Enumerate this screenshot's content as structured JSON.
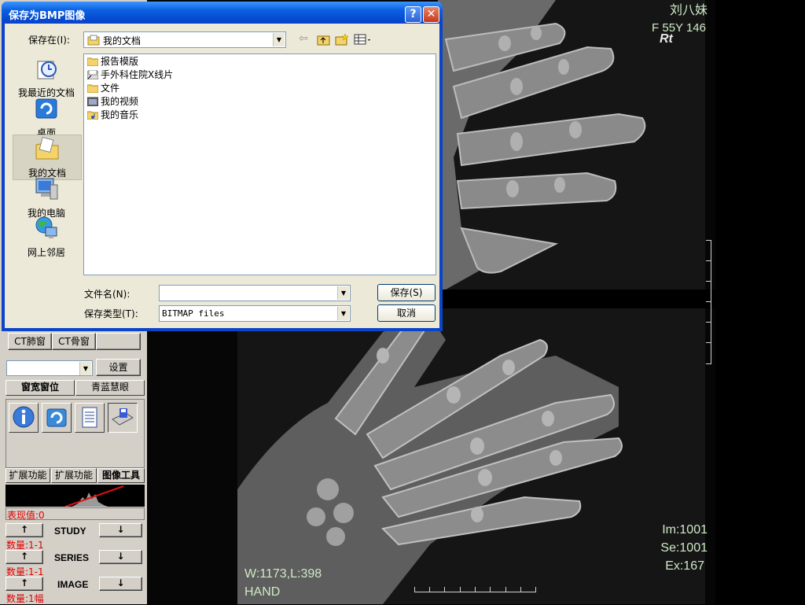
{
  "dialog": {
    "title": "保存为BMP图像",
    "help_label": "?",
    "close_label": "✕",
    "save_in_label": "保存在(I):",
    "save_in_value": "我的文档",
    "places": [
      {
        "label": "我最近的文档",
        "icon": "recent-docs-icon"
      },
      {
        "label": "桌面",
        "icon": "desktop-icon"
      },
      {
        "label": "我的文档",
        "icon": "my-documents-icon"
      },
      {
        "label": "我的电脑",
        "icon": "my-computer-icon"
      },
      {
        "label": "网上邻居",
        "icon": "network-places-icon"
      }
    ],
    "files": [
      {
        "name": "报告模版",
        "icon": "folder-icon"
      },
      {
        "name": "手外科住院X线片",
        "icon": "shortcut-folder-icon"
      },
      {
        "name": "文件",
        "icon": "folder-icon"
      },
      {
        "name": "我的视频",
        "icon": "video-folder-icon"
      },
      {
        "name": "我的音乐",
        "icon": "music-folder-icon"
      }
    ],
    "filename_label": "文件名(N):",
    "filename_value": "",
    "filetype_label": "保存类型(T):",
    "filetype_value": "BITMAP files",
    "save_button": "保存(S)",
    "cancel_button": "取消"
  },
  "left_panel": {
    "ct_lung": "CT肺窗",
    "ct_bone": "CT骨窗",
    "settings_button": "设置",
    "preset_select_value": "",
    "tab_window": "窗宽窗位",
    "tab_cyan": "青蓝慧眼",
    "bottom_tabs": [
      "扩展功能",
      "扩展功能",
      "图像工具"
    ],
    "value_label": "表现值:0",
    "study_label": "STUDY",
    "study_count": "数量:1-1",
    "series_label": "SERIES",
    "series_count": "数量:1-1",
    "image_label": "IMAGE",
    "image_count": "数量:1幅",
    "up_arrow": "↑",
    "down_arrow": "↓"
  },
  "viewer": {
    "patient_name": "刘八妹",
    "patient_info": "F  55Y 146",
    "marker": "Rt",
    "im": "Im:1001",
    "se": "Se:1001",
    "ex": "Ex:167",
    "wl": "W:1173,L:398",
    "body_part": "HAND"
  }
}
